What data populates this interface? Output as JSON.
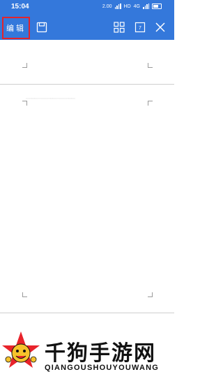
{
  "status_bar": {
    "time": "15:04",
    "speed": "2.00",
    "hd_label": "HD",
    "net_label": "4G"
  },
  "toolbar": {
    "edit_label": "编辑",
    "icons": [
      "save-icon",
      "grid-icon",
      "page-icon",
      "close-icon"
    ],
    "page_number": "7"
  },
  "document": {
    "faint_line": "''''''''''''''''''''''''''''''''''''''''''''''''''''''''''''''''''''''''''"
  },
  "watermark": {
    "title": "千狗手游网",
    "subtitle": "QIANGOUSHOUYOUWANG"
  },
  "colors": {
    "toolbar": "#3478db",
    "highlight": "#e3232b"
  }
}
